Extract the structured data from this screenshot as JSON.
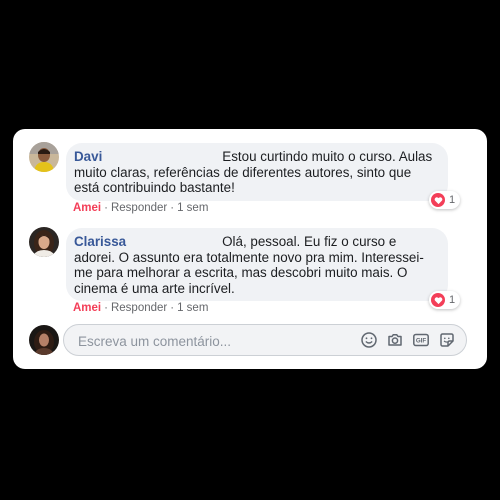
{
  "comments": [
    {
      "author": "Davi",
      "text": "Estou curtindo muito o curso. Aulas muito claras, referências de diferentes autores, sinto que está contribuindo bastante!",
      "reaction_count": "1",
      "actions": {
        "love": "Amei",
        "reply": "Responder",
        "time": "1 sem"
      }
    },
    {
      "author": "Clarissa",
      "text": "Olá, pessoal. Eu fiz o curso e adorei. O assunto era totalmente novo pra mim. Interessei-me para melhorar a escrita, mas descobri muito mais. O cinema é uma arte incrível.",
      "reaction_count": "1",
      "actions": {
        "love": "Amei",
        "reply": "Responder",
        "time": "1 sem"
      }
    }
  ],
  "composer": {
    "placeholder": "Escreva um comentário...",
    "icons": [
      "emoji-icon",
      "camera-icon",
      "gif-icon",
      "sticker-icon"
    ]
  },
  "colors": {
    "background": "#000000",
    "card": "#ffffff",
    "bubble": "#f0f2f5",
    "author": "#385898",
    "love": "#f33e58",
    "meta": "#65676b"
  }
}
